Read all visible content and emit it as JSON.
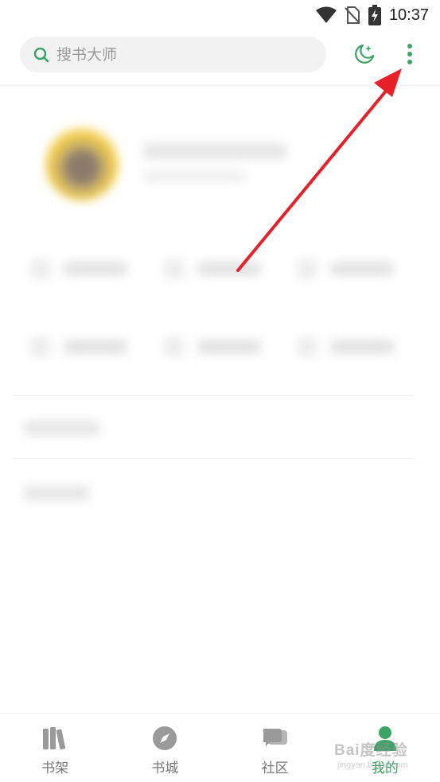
{
  "status_bar": {
    "time": "10:37",
    "icons": [
      "wifi-icon",
      "no-sim-icon",
      "battery-charging-icon"
    ]
  },
  "search": {
    "placeholder": "搜书大师",
    "icon": "search-icon"
  },
  "header_actions": {
    "night_mode_icon": "moon-stars-icon",
    "more_icon": "more-vertical-icon"
  },
  "colors": {
    "accent": "#3ca266",
    "annotation_arrow": "#e8202a",
    "search_bg": "#f1f2f1"
  },
  "bottom_nav": {
    "items": [
      {
        "label": "书架",
        "icon": "bookshelf-icon",
        "active": false
      },
      {
        "label": "书城",
        "icon": "compass-icon",
        "active": false
      },
      {
        "label": "社区",
        "icon": "chat-icon",
        "active": false
      },
      {
        "label": "我的",
        "icon": "user-icon",
        "active": true
      }
    ]
  },
  "watermark": {
    "text": "Bai度经验",
    "sub": "jingyan.baidu.com"
  }
}
